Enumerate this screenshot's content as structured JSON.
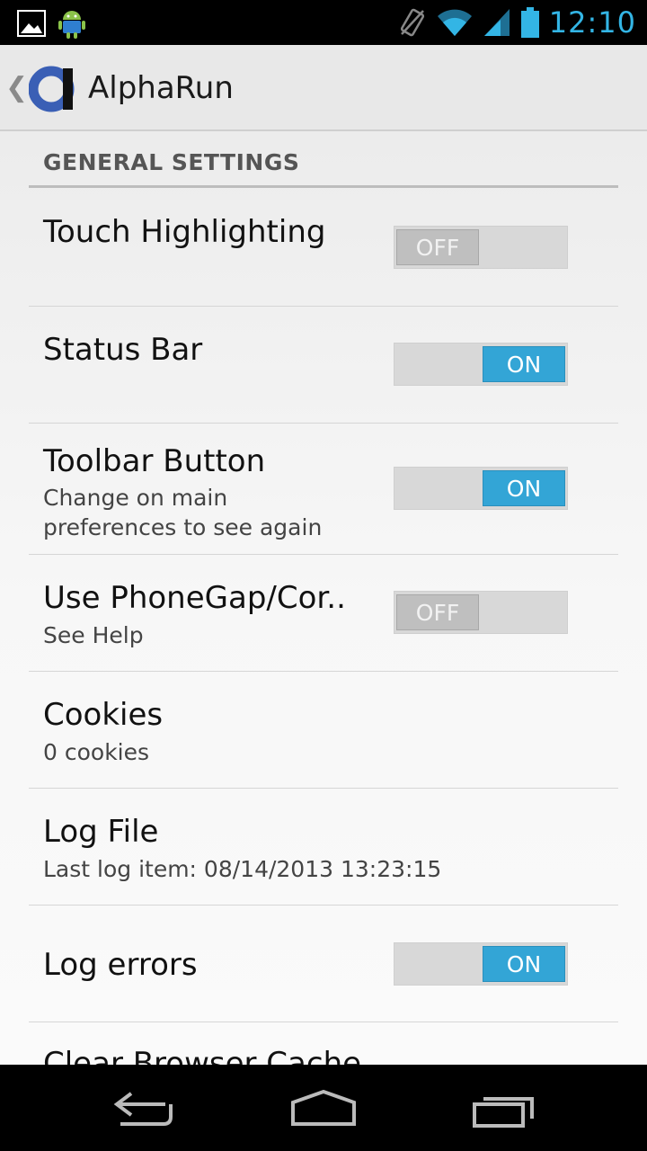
{
  "status_bar": {
    "left_icons": [
      "image-icon",
      "android-icon"
    ],
    "right_icons": [
      "vibrate-icon",
      "wifi-icon",
      "signal-icon",
      "battery-icon"
    ],
    "clock": "12:10",
    "clock_color": "#33b5e5"
  },
  "action_bar": {
    "title": "AlphaRun",
    "logo_color": "#3a5fb5"
  },
  "section": {
    "title": "GENERAL SETTINGS"
  },
  "settings": [
    {
      "title": "Touch Highlighting",
      "summary": "",
      "toggle": "OFF"
    },
    {
      "title": "Status Bar",
      "summary": "",
      "toggle": "ON"
    },
    {
      "title": "Toolbar Button",
      "summary": "Change on main\npreferences to see again",
      "toggle": "ON"
    },
    {
      "title": "Use PhoneGap/Cor..",
      "summary": "See Help",
      "toggle": "OFF"
    },
    {
      "title": "Cookies",
      "summary": "0 cookies"
    },
    {
      "title": "Log File",
      "summary": "Last log item: 08/14/2013 13:23:15"
    },
    {
      "title": "Log errors",
      "summary": "",
      "toggle": "ON"
    },
    {
      "title": "Clear Browser Cache",
      "summary": ""
    }
  ],
  "accent_on": "#33a5d6",
  "nav_bar": {
    "buttons": [
      "back-icon",
      "home-icon",
      "recents-icon"
    ]
  }
}
